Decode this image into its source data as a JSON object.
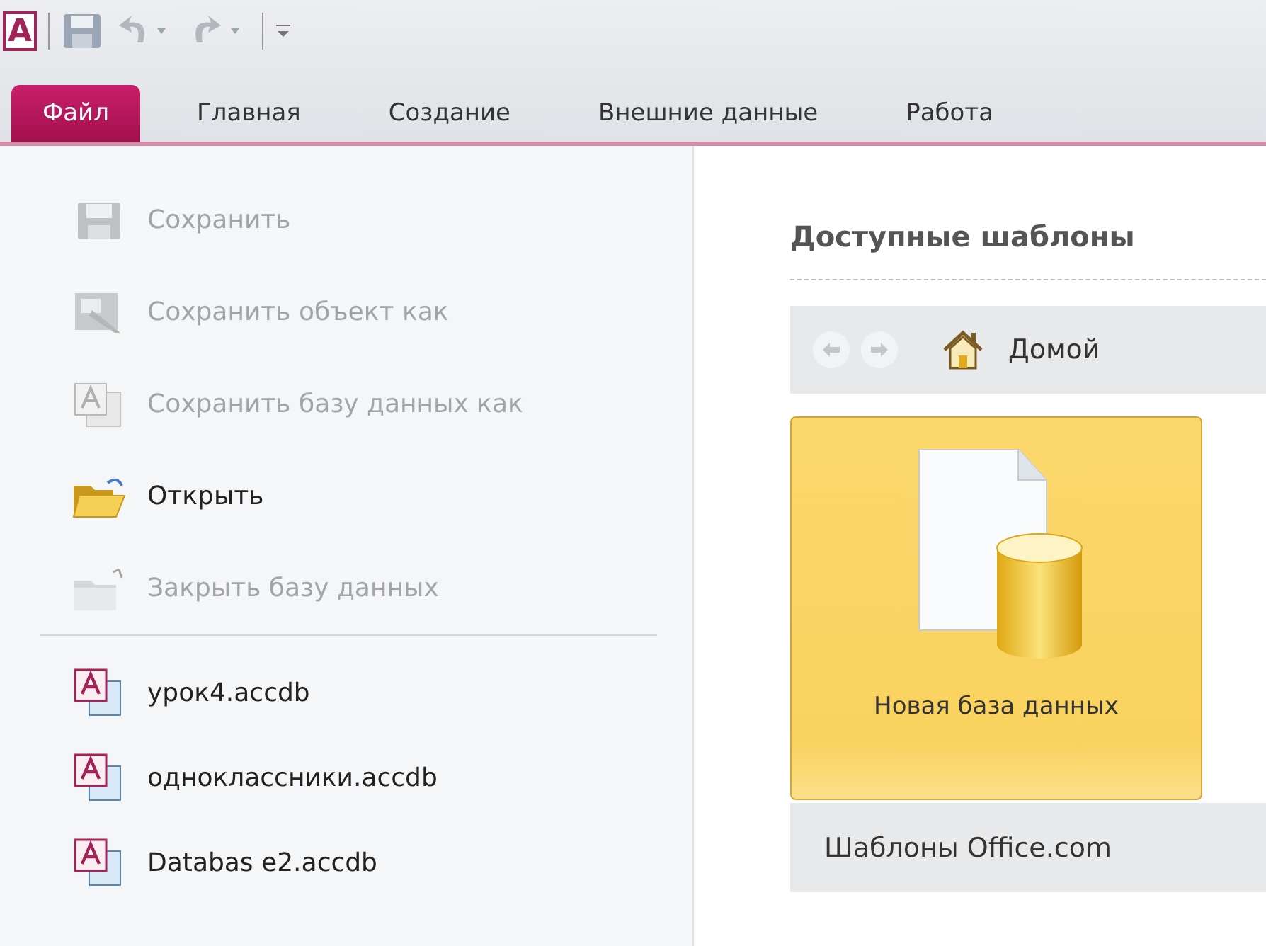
{
  "quick_access": {
    "logo_letter": "A"
  },
  "tabs": [
    {
      "label": "Файл",
      "selected": true
    },
    {
      "label": "Главная",
      "selected": false
    },
    {
      "label": "Создание",
      "selected": false
    },
    {
      "label": "Внешние данные",
      "selected": false
    },
    {
      "label": "Работа",
      "selected": false
    }
  ],
  "menu": {
    "commands": [
      {
        "kind": "save",
        "label": "Сохранить",
        "disabled": true
      },
      {
        "kind": "save-object",
        "label": "Сохранить объект как",
        "disabled": true
      },
      {
        "kind": "save-db",
        "label": "Сохранить базу данных как",
        "disabled": true
      },
      {
        "kind": "open",
        "label": "Открыть",
        "disabled": false
      },
      {
        "kind": "close",
        "label": "Закрыть базу данных",
        "disabled": true
      }
    ],
    "recent_files": [
      "урок4.accdb",
      "одноклассники.accdb",
      "Databas e2.accdb"
    ]
  },
  "templates": {
    "title": "Доступные шаблоны",
    "breadcrumb": "Домой",
    "tiles": [
      {
        "label": "Новая база данных",
        "selected": true
      }
    ],
    "section": "Шаблоны Office.com"
  }
}
